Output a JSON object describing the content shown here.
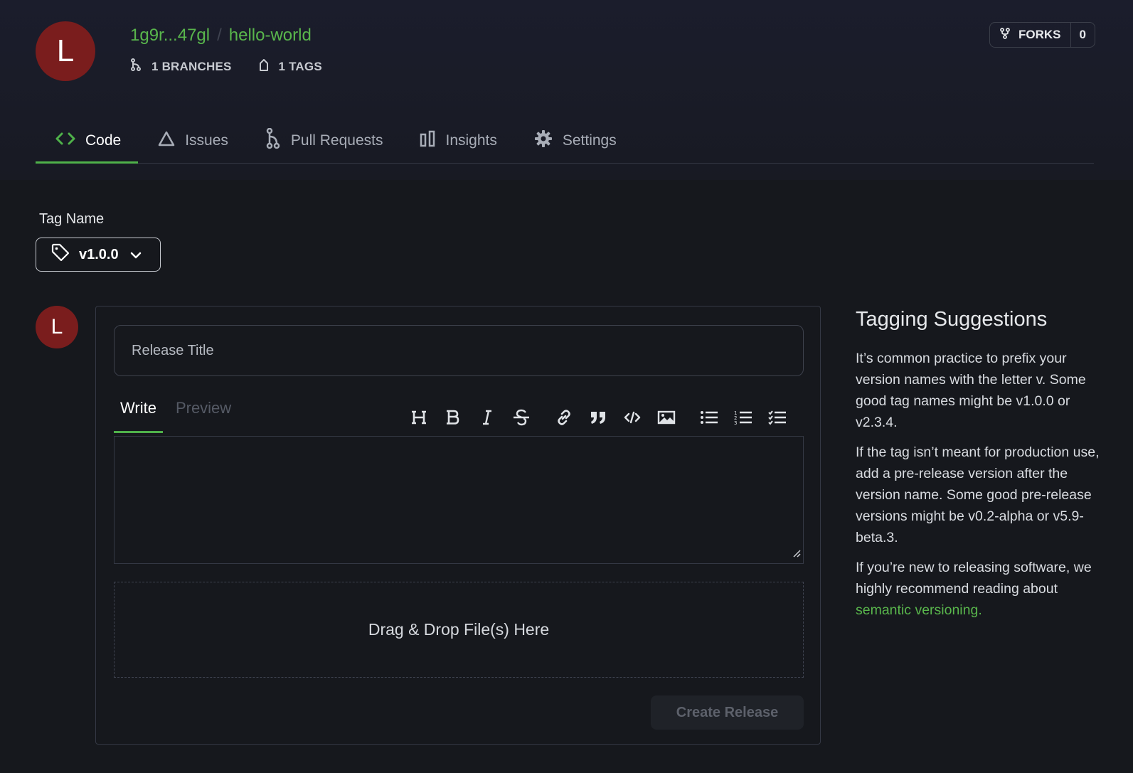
{
  "repo": {
    "avatar_letter": "L",
    "owner": "1g9r...47gl",
    "separator": "/",
    "name": "hello-world",
    "branches_label": "1 BRANCHES",
    "tags_label": "1 TAGS",
    "forks_label": "FORKS",
    "forks_count": "0"
  },
  "tabs": [
    {
      "label": "Code",
      "icon": "code-icon",
      "active": true
    },
    {
      "label": "Issues",
      "icon": "triangle-icon"
    },
    {
      "label": "Pull Requests",
      "icon": "pull-request-icon"
    },
    {
      "label": "Insights",
      "icon": "bar-chart-icon"
    },
    {
      "label": "Settings",
      "icon": "gear-icon"
    }
  ],
  "tag": {
    "label": "Tag Name",
    "value": "v1.0.0"
  },
  "form": {
    "avatar_letter": "L",
    "title_placeholder": "Release Title",
    "write_tab": "Write",
    "preview_tab": "Preview",
    "toolbar": [
      "heading-icon",
      "bold-icon",
      "italic-icon",
      "strikethrough-icon",
      "link-icon",
      "quote-icon",
      "code-icon",
      "image-icon",
      "bullet-list-icon",
      "numbered-list-icon",
      "task-list-icon"
    ],
    "dropzone_text": "Drag & Drop File(s) Here",
    "create_button": "Create Release"
  },
  "suggestions": {
    "title": "Tagging Suggestions",
    "p1": "It’s common practice to prefix your version names with the letter v. Some good tag names might be v1.0.0 or v2.3.4.",
    "p2": "If the tag isn’t meant for production use, add a pre-release version after the version name. Some good pre-release versions might be v0.2-alpha or v5.9-beta.3.",
    "p3_prefix": "If you’re new to releasing software, we highly recommend reading about ",
    "p3_link": "semantic versioning."
  },
  "colors": {
    "accent": "#4fb14a",
    "avatar": "#7a1d1d",
    "background": "#16181d"
  }
}
